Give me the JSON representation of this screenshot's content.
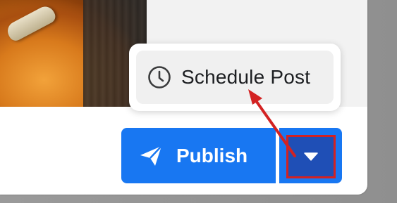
{
  "popover": {
    "schedule_label": "Schedule Post",
    "icon": "clock-icon"
  },
  "publish": {
    "label": "Publish",
    "icon": "paper-plane-icon"
  },
  "dropdown": {
    "icon": "caret-down-icon"
  },
  "colors": {
    "publish_blue": "#1877f2",
    "annotation_red": "#d32222"
  }
}
